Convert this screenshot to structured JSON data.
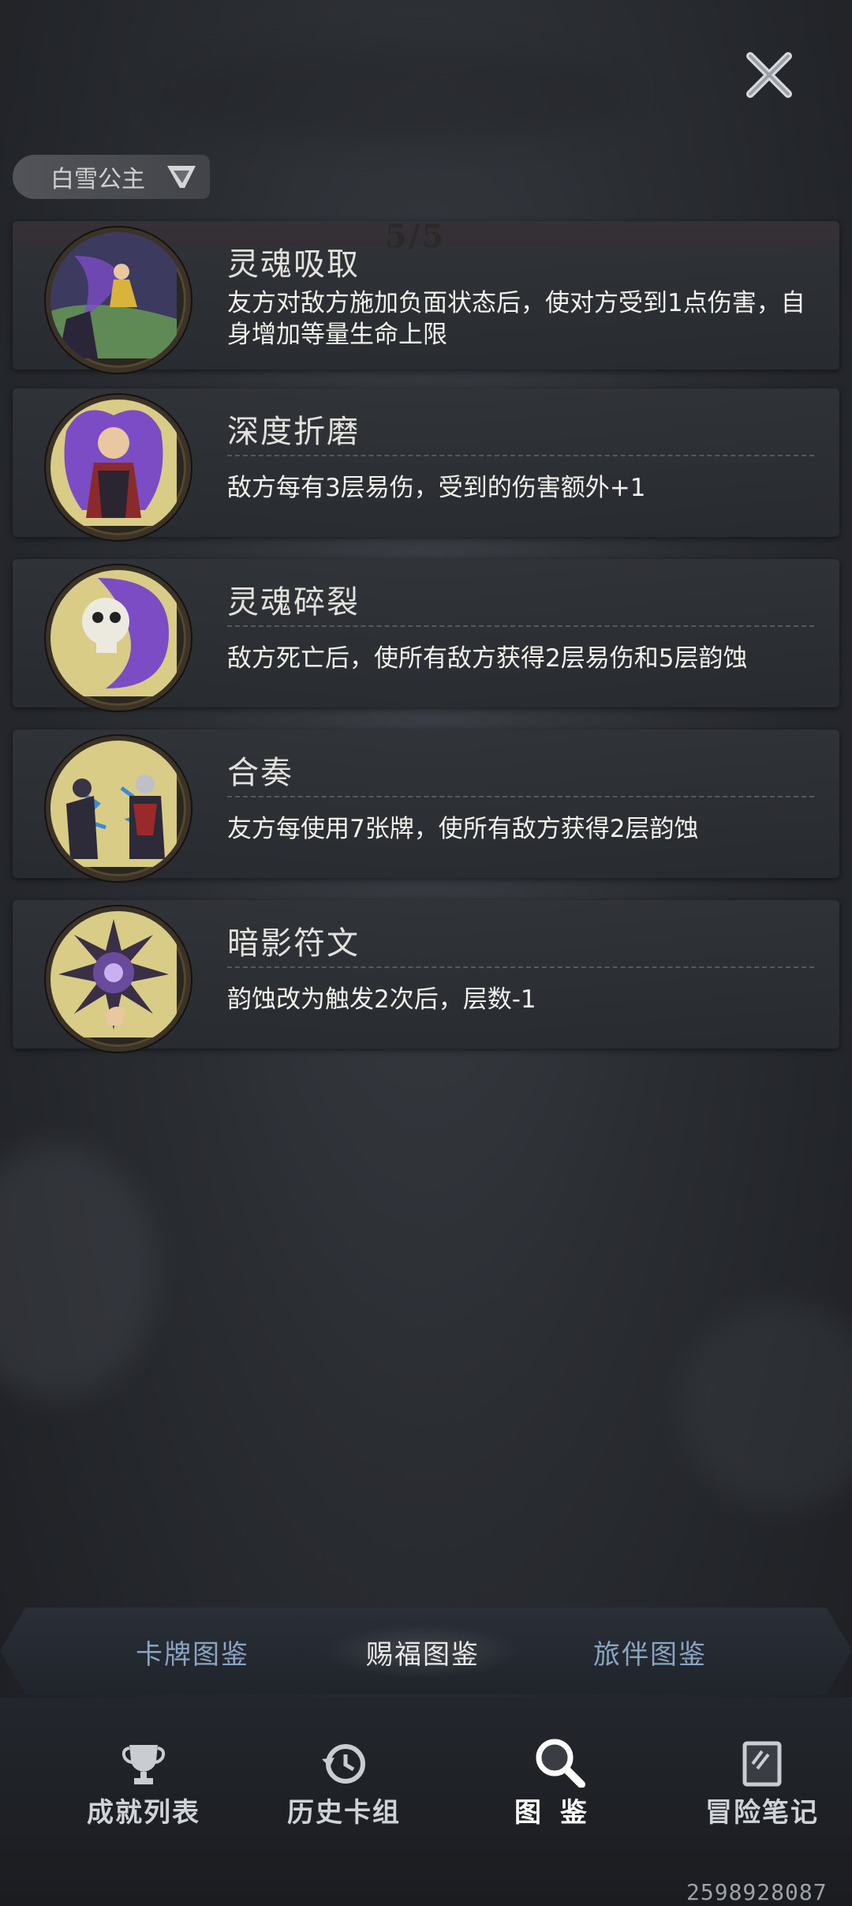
{
  "header": {
    "character_name": "白雪公主"
  },
  "progress": {
    "count": "5/5"
  },
  "blessings": [
    {
      "title": "灵魂吸取",
      "desc": "友方对敌方施加负面状态后，使对方受到1点伤害，自身增加等量生命上限"
    },
    {
      "title": "深度折磨",
      "desc": "敌方每有3层易伤，受到的伤害额外+1"
    },
    {
      "title": "灵魂碎裂",
      "desc": "敌方死亡后，使所有敌方获得2层易伤和5层韵蚀"
    },
    {
      "title": "合奏",
      "desc": "友方每使用7张牌，使所有敌方获得2层韵蚀"
    },
    {
      "title": "暗影符文",
      "desc": "韵蚀改为触发2次后，层数-1"
    }
  ],
  "tabs": {
    "cards": "卡牌图鉴",
    "blessings": "赐福图鉴",
    "companions": "旅伴图鉴",
    "active": "赐福图鉴"
  },
  "nav": {
    "achievements": "成就列表",
    "history": "历史卡组",
    "codex": "图鉴",
    "notes": "冒险笔记"
  },
  "watermark": "2598928087"
}
